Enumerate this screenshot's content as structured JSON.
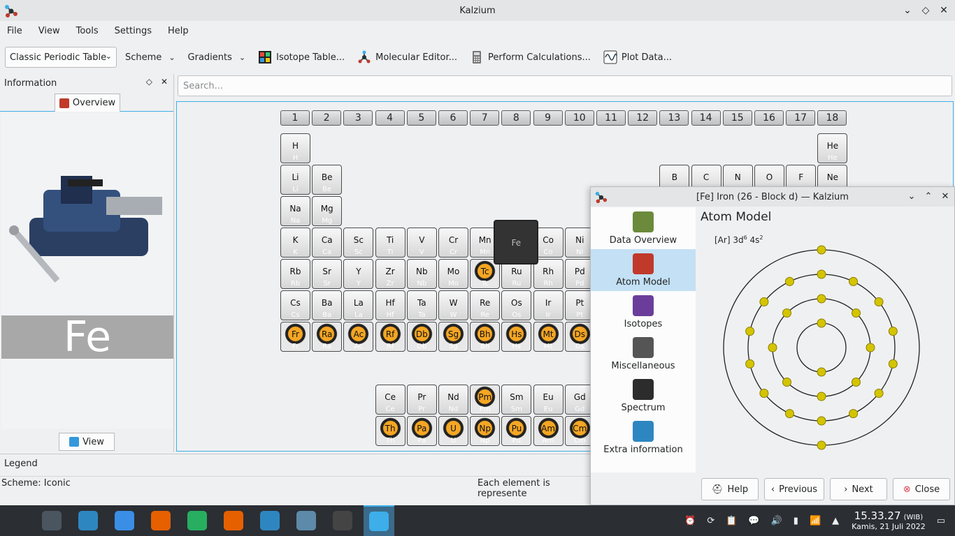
{
  "window": {
    "title": "Kalzium"
  },
  "menu": [
    "File",
    "View",
    "Tools",
    "Settings",
    "Help"
  ],
  "toolbar": {
    "table_combo": "Classic Periodic Table",
    "scheme": "Scheme",
    "gradients": "Gradients",
    "isotope_table": "Isotope Table...",
    "molecular_editor": "Molecular Editor...",
    "perform_calculations": "Perform Calculations...",
    "plot_data": "Plot Data..."
  },
  "info_panel": {
    "title": "Information",
    "tab": "Overview",
    "symbol": "Fe",
    "view_tab": "View"
  },
  "search": {
    "placeholder": "Search..."
  },
  "groups": [
    "1",
    "2",
    "3",
    "4",
    "5",
    "6",
    "7",
    "8",
    "9",
    "10",
    "11",
    "12",
    "13",
    "14",
    "15",
    "16",
    "17",
    "18"
  ],
  "elements": [
    {
      "s": "H",
      "c": 1,
      "r": 1
    },
    {
      "s": "He",
      "c": 18,
      "r": 1
    },
    {
      "s": "Li",
      "c": 1,
      "r": 2
    },
    {
      "s": "Be",
      "c": 2,
      "r": 2
    },
    {
      "s": "B",
      "c": 13,
      "r": 2
    },
    {
      "s": "C",
      "c": 14,
      "r": 2
    },
    {
      "s": "N",
      "c": 15,
      "r": 2
    },
    {
      "s": "O",
      "c": 16,
      "r": 2
    },
    {
      "s": "F",
      "c": 17,
      "r": 2
    },
    {
      "s": "Ne",
      "c": 18,
      "r": 2
    },
    {
      "s": "Na",
      "c": 1,
      "r": 3
    },
    {
      "s": "Mg",
      "c": 2,
      "r": 3
    },
    {
      "s": "K",
      "c": 1,
      "r": 4
    },
    {
      "s": "Ca",
      "c": 2,
      "r": 4
    },
    {
      "s": "Sc",
      "c": 3,
      "r": 4
    },
    {
      "s": "Ti",
      "c": 4,
      "r": 4
    },
    {
      "s": "V",
      "c": 5,
      "r": 4
    },
    {
      "s": "Cr",
      "c": 6,
      "r": 4
    },
    {
      "s": "Mn",
      "c": 7,
      "r": 4
    },
    {
      "s": "Co",
      "c": 9,
      "r": 4
    },
    {
      "s": "Ni",
      "c": 10,
      "r": 4
    },
    {
      "s": "Rb",
      "c": 1,
      "r": 5
    },
    {
      "s": "Sr",
      "c": 2,
      "r": 5
    },
    {
      "s": "Y",
      "c": 3,
      "r": 5
    },
    {
      "s": "Zr",
      "c": 4,
      "r": 5
    },
    {
      "s": "Nb",
      "c": 5,
      "r": 5
    },
    {
      "s": "Mo",
      "c": 6,
      "r": 5
    },
    {
      "s": "Tc",
      "c": 7,
      "r": 5,
      "rad": true
    },
    {
      "s": "Ru",
      "c": 8,
      "r": 5
    },
    {
      "s": "Rh",
      "c": 9,
      "r": 5
    },
    {
      "s": "Pd",
      "c": 10,
      "r": 5
    },
    {
      "s": "Cs",
      "c": 1,
      "r": 6
    },
    {
      "s": "Ba",
      "c": 2,
      "r": 6
    },
    {
      "s": "La",
      "c": 3,
      "r": 6
    },
    {
      "s": "Hf",
      "c": 4,
      "r": 6
    },
    {
      "s": "Ta",
      "c": 5,
      "r": 6
    },
    {
      "s": "W",
      "c": 6,
      "r": 6
    },
    {
      "s": "Re",
      "c": 7,
      "r": 6
    },
    {
      "s": "Os",
      "c": 8,
      "r": 6
    },
    {
      "s": "Ir",
      "c": 9,
      "r": 6
    },
    {
      "s": "Pt",
      "c": 10,
      "r": 6
    },
    {
      "s": "Fr",
      "c": 1,
      "r": 7,
      "rad": true
    },
    {
      "s": "Ra",
      "c": 2,
      "r": 7,
      "rad": true
    },
    {
      "s": "Ac",
      "c": 3,
      "r": 7,
      "rad": true
    },
    {
      "s": "Rf",
      "c": 4,
      "r": 7,
      "rad": true
    },
    {
      "s": "Db",
      "c": 5,
      "r": 7,
      "rad": true
    },
    {
      "s": "Sg",
      "c": 6,
      "r": 7,
      "rad": true
    },
    {
      "s": "Bh",
      "c": 7,
      "r": 7,
      "rad": true
    },
    {
      "s": "Hs",
      "c": 8,
      "r": 7,
      "rad": true
    },
    {
      "s": "Mt",
      "c": 9,
      "r": 7,
      "rad": true
    },
    {
      "s": "Ds",
      "c": 10,
      "r": 7,
      "rad": true
    },
    {
      "s": "Ce",
      "c": 4,
      "r": 9
    },
    {
      "s": "Pr",
      "c": 5,
      "r": 9
    },
    {
      "s": "Nd",
      "c": 6,
      "r": 9
    },
    {
      "s": "Pm",
      "c": 7,
      "r": 9,
      "rad": true
    },
    {
      "s": "Sm",
      "c": 8,
      "r": 9
    },
    {
      "s": "Eu",
      "c": 9,
      "r": 9
    },
    {
      "s": "Gd",
      "c": 10,
      "r": 9
    },
    {
      "s": "Th",
      "c": 4,
      "r": 10,
      "rad": true
    },
    {
      "s": "Pa",
      "c": 5,
      "r": 10,
      "rad": true
    },
    {
      "s": "U",
      "c": 6,
      "r": 10,
      "rad": true
    },
    {
      "s": "Np",
      "c": 7,
      "r": 10,
      "rad": true
    },
    {
      "s": "Pu",
      "c": 8,
      "r": 10,
      "rad": true
    },
    {
      "s": "Am",
      "c": 9,
      "r": 10,
      "rad": true
    },
    {
      "s": "Cm",
      "c": 10,
      "r": 10,
      "rad": true
    }
  ],
  "selected_element": "Fe",
  "legend": {
    "title": "Legend",
    "scheme": "Scheme: Iconic",
    "note": "Each element is represente"
  },
  "dialog": {
    "title": "[Fe] Iron (26 - Block d) — Kalzium",
    "page_title": "Atom Model",
    "config_base": "[Ar] 3d",
    "config_d": "6",
    "config_mid": " 4s",
    "config_s": "2",
    "shells": [
      2,
      8,
      14,
      2
    ],
    "sidebar": [
      {
        "label": "Data Overview",
        "icon": "flask-icon",
        "color": "#6b8a3b"
      },
      {
        "label": "Atom Model",
        "icon": "atom-icon",
        "color": "#c0392b"
      },
      {
        "label": "Isotopes",
        "icon": "isotope-grid-icon",
        "color": "#6a3d9a"
      },
      {
        "label": "Miscellaneous",
        "icon": "document-icon",
        "color": "#555555"
      },
      {
        "label": "Spectrum",
        "icon": "spectrum-icon",
        "color": "#2c2c2c"
      },
      {
        "label": "Extra information",
        "icon": "globe-icon",
        "color": "#2e86c1"
      }
    ],
    "active_index": 1,
    "buttons": {
      "help": "Help",
      "previous": "Previous",
      "next": "Next",
      "close": "Close"
    }
  },
  "taskbar": {
    "apps": [
      "app-launcher-icon",
      "system-settings-icon",
      "discover-store-icon",
      "file-manager-icon",
      "firefox-icon",
      "spreadsheet-icon",
      "firefox-alt-icon",
      "document-writer-icon",
      "mail-client-icon",
      "terminal-icon",
      "kalzium-icon"
    ],
    "time": "15.33.27",
    "timezone": "(WIB)",
    "date": "Kamis, 21 Juli 2022"
  },
  "colors": {
    "accent": "#3daee9",
    "electron": "#d4c400",
    "radioactive": "#f5a623"
  }
}
